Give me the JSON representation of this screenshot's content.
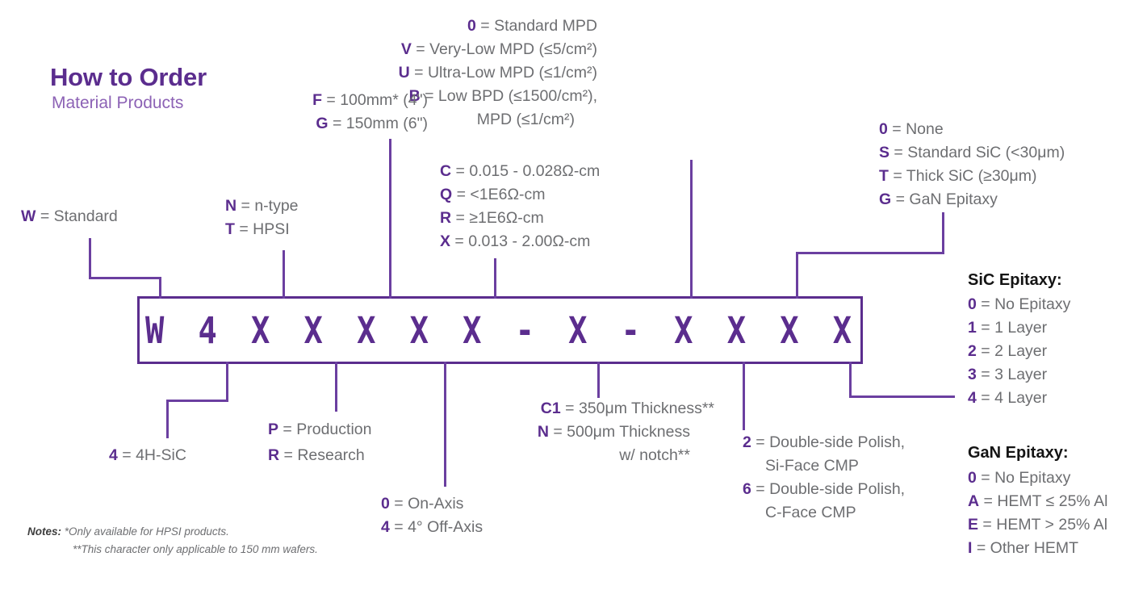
{
  "title": "How to Order",
  "subtitle": "Material Products",
  "part_number": "W 4 X X X X X - X - X X X X",
  "groups": {
    "standard": {
      "items": [
        {
          "key": "W",
          "text": " = Standard"
        }
      ]
    },
    "type": {
      "items": [
        {
          "key": "N",
          "text": " = n-type"
        },
        {
          "key": "T",
          "text": " = HPSI"
        }
      ]
    },
    "diameter": {
      "items": [
        {
          "key": "F",
          "text": " = 100mm* (4\")"
        },
        {
          "key": "G",
          "text": " = 150mm (6\")"
        }
      ]
    },
    "resistivity": {
      "items": [
        {
          "key": "C",
          "text": " = 0.015 - 0.028Ω-cm"
        },
        {
          "key": "Q",
          "text": " = <1E6Ω-cm"
        },
        {
          "key": "R",
          "text": " = ≥1E6Ω-cm"
        },
        {
          "key": "X",
          "text": " = 0.013 - 2.00Ω-cm"
        }
      ]
    },
    "defect": {
      "items": [
        {
          "key": "0",
          "text": " = Standard MPD"
        },
        {
          "key": "V",
          "text": " = Very-Low MPD (≤5/cm²)"
        },
        {
          "key": "U",
          "text": " = Ultra-Low MPD (≤1/cm²)"
        },
        {
          "key": "B",
          "text": " = Low BPD (≤1500/cm²),"
        },
        {
          "key": "",
          "text": "MPD (≤1/cm²)"
        }
      ]
    },
    "epitaxy": {
      "items": [
        {
          "key": "0",
          "text": " = None"
        },
        {
          "key": "S",
          "text": " = Standard SiC (<30μm)"
        },
        {
          "key": "T",
          "text": " = Thick SiC (≥30μm)"
        },
        {
          "key": "G",
          "text": " = GaN Epitaxy"
        }
      ]
    },
    "polytype": {
      "items": [
        {
          "key": "4",
          "text": " = 4H-SiC"
        }
      ]
    },
    "grade": {
      "items": [
        {
          "key": "P",
          "text": " = Production"
        },
        {
          "key": "R",
          "text": " = Research"
        }
      ]
    },
    "axis": {
      "items": [
        {
          "key": "0",
          "text": " = On-Axis"
        },
        {
          "key": "4",
          "text": " = 4° Off-Axis"
        }
      ]
    },
    "thickness": {
      "items": [
        {
          "key": "C1",
          "text": " = 350μm Thickness**"
        },
        {
          "key": "N",
          "text": " = 500μm Thickness"
        },
        {
          "key": "",
          "text": "w/ notch**"
        }
      ]
    },
    "polish": {
      "items": [
        {
          "key": "2",
          "text": " = Double-side Polish,"
        },
        {
          "key": "",
          "text": "Si-Face CMP"
        },
        {
          "key": "6",
          "text": " = Double-side Polish,"
        },
        {
          "key": "",
          "text": "C-Face CMP"
        }
      ]
    },
    "sic_epitaxy": {
      "header": "SiC Epitaxy:",
      "items": [
        {
          "key": "0",
          "text": " = No Epitaxy"
        },
        {
          "key": "1",
          "text": " = 1 Layer"
        },
        {
          "key": "2",
          "text": " = 2 Layer"
        },
        {
          "key": "3",
          "text": " = 3 Layer"
        },
        {
          "key": "4",
          "text": " = 4 Layer"
        }
      ]
    },
    "gan_epitaxy": {
      "header": "GaN Epitaxy:",
      "items": [
        {
          "key": "0",
          "text": " = No Epitaxy"
        },
        {
          "key": "A",
          "text": " = HEMT ≤ 25% Al"
        },
        {
          "key": "E",
          "text": " = HEMT > 25% Al"
        },
        {
          "key": "I",
          "text": " = Other HEMT"
        }
      ]
    }
  },
  "notes": {
    "label": "Notes:",
    "line1": "*Only available for HPSI products.",
    "line2": "**This character only applicable to 150 mm wafers."
  },
  "colors": {
    "purple": "#5b2d8e",
    "line_purple": "#6b3fa0",
    "light_purple": "#8c62b5",
    "gray_text": "#6d6e71",
    "black_header": "#141414"
  }
}
